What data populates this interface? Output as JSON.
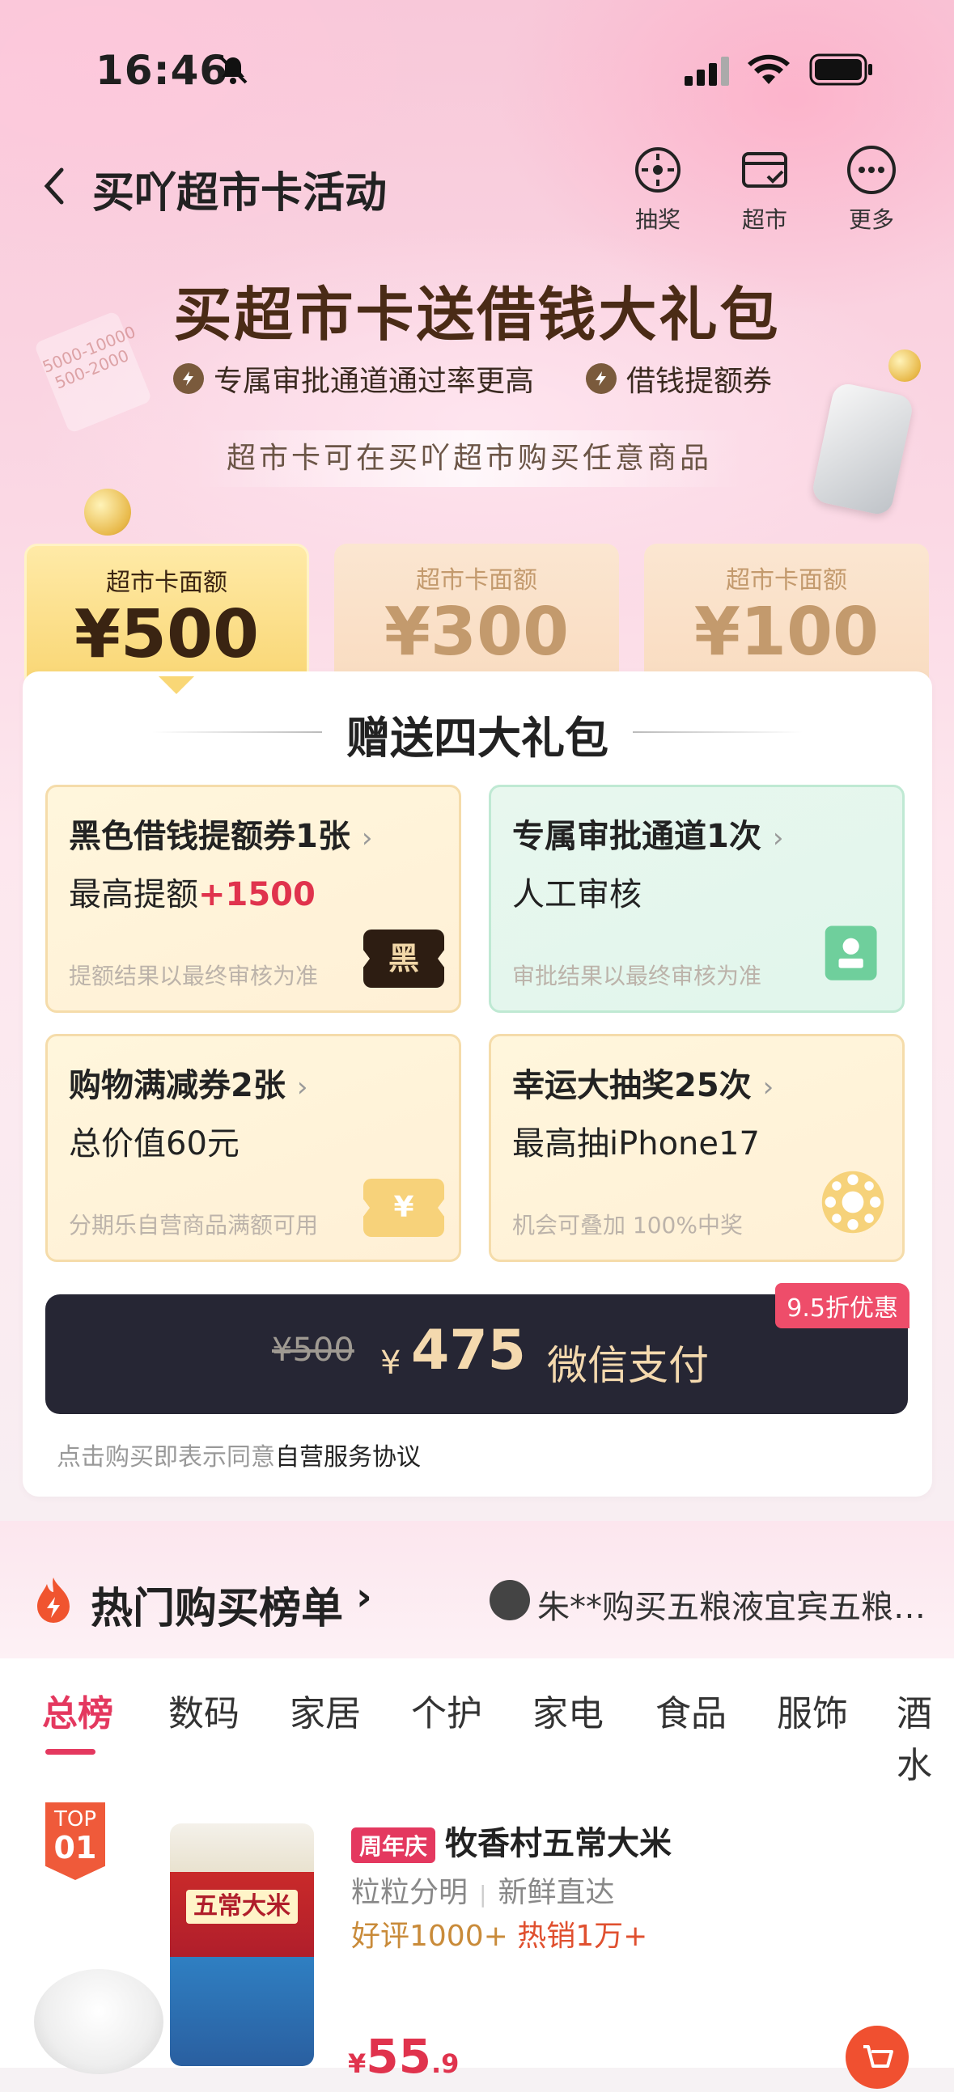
{
  "status_bar": {
    "time": "16:46"
  },
  "nav": {
    "title": "买吖超市卡活动",
    "actions": [
      {
        "icon": "lottery-wheel-icon",
        "label": "抽奖"
      },
      {
        "icon": "supermarket-card-icon",
        "label": "超市"
      },
      {
        "icon": "more-dots-icon",
        "label": "更多"
      }
    ]
  },
  "hero": {
    "headline": "买超市卡送借钱大礼包",
    "features": [
      "专属审批通道通过率更高",
      "借钱提额券"
    ],
    "subtitle": "超市卡可在买吖超市购买任意商品",
    "ticket_text": "5000-10000\n500-2000"
  },
  "amounts": [
    {
      "label": "超市卡面额",
      "value": "¥500",
      "selected": true
    },
    {
      "label": "超市卡面额",
      "value": "¥300",
      "selected": false
    },
    {
      "label": "超市卡面额",
      "value": "¥100",
      "selected": false
    }
  ],
  "gift": {
    "title": "赠送四大礼包",
    "cards": [
      {
        "title": "黑色借钱提额券1张",
        "line2": "最高提额",
        "highlight": "+1500",
        "note": "提额结果以最终审核为准",
        "badge": "黑",
        "theme": "y"
      },
      {
        "title": "专属审批通道1次",
        "line2": "人工审核",
        "highlight": "",
        "note": "审批结果以最终审核为准",
        "badge": "",
        "theme": "g"
      },
      {
        "title": "购物满减券2张",
        "line2": "总价值60元",
        "highlight": "",
        "note": "分期乐自营商品满额可用",
        "badge": "¥",
        "theme": "y"
      },
      {
        "title": "幸运大抽奖25次",
        "line2": "最高抽iPhone17",
        "highlight": "",
        "note": "机会可叠加 100%中奖",
        "badge": "",
        "theme": "y"
      }
    ]
  },
  "pay": {
    "old_price": "¥500",
    "currency": "¥",
    "price": "475",
    "action": "微信支付",
    "discount": "9.5折优惠",
    "agreement_prefix": "点击购买即表示同意",
    "agreement_link": "自营服务协议"
  },
  "hot_list": {
    "title": "热门购买榜单",
    "arrow": "›",
    "ticker": "朱**购买五粮液宜宾五粮…"
  },
  "tabs": [
    "总榜",
    "数码",
    "家居",
    "个护",
    "家电",
    "食品",
    "服饰",
    "酒水"
  ],
  "product": {
    "rank_top": "TOP",
    "rank_num": "01",
    "tag": "周年庆",
    "name": "牧香村五常大米",
    "sub1": "粒粒分明",
    "sub2": "新鲜直达",
    "reviews": "好评1000+",
    "sales": "热销1万+",
    "price_symbol": "¥",
    "price_int": "55",
    "price_dec": ".9",
    "bag_label": "五常大米"
  }
}
